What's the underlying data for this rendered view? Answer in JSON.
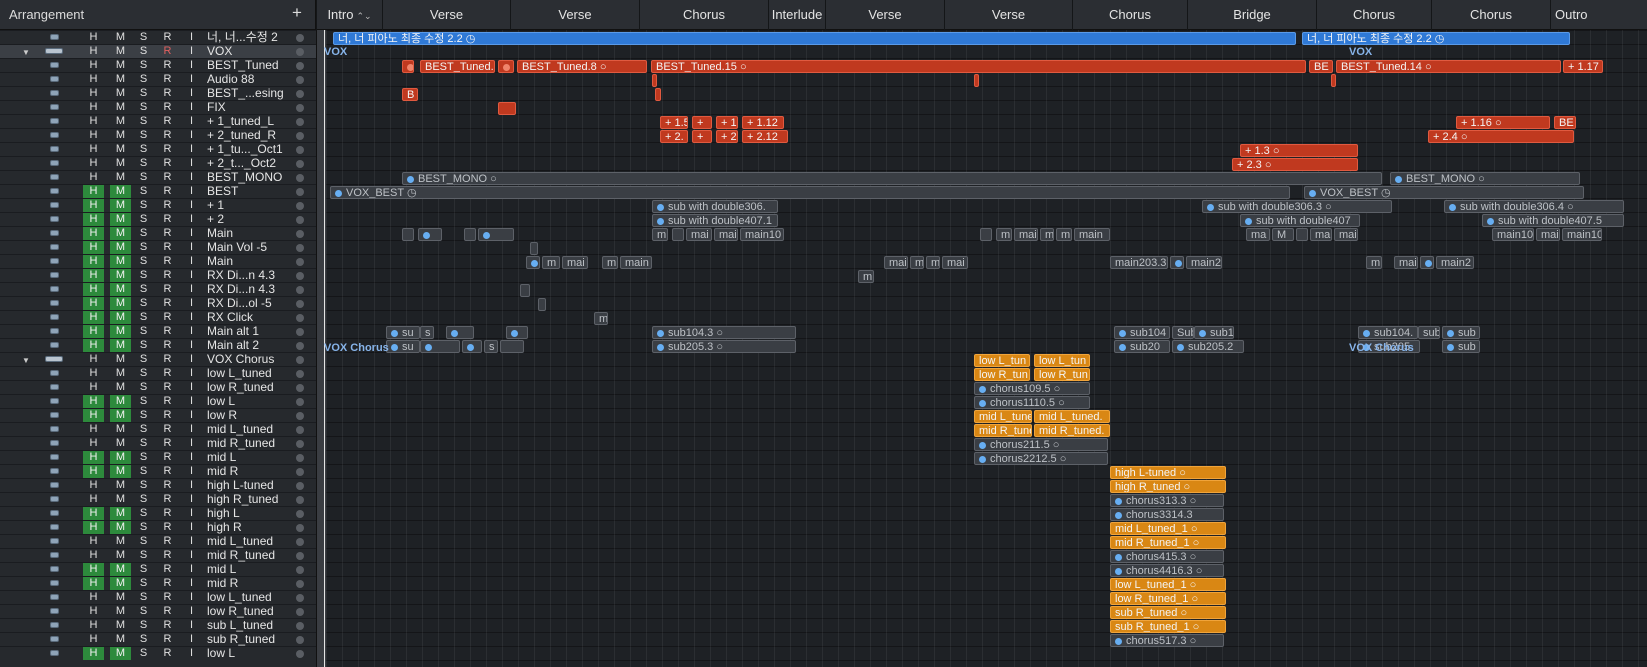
{
  "header": {
    "title": "Arrangement",
    "add": "+"
  },
  "markers": [
    {
      "label": "Intro",
      "caret": "⌃⌄"
    },
    {
      "label": "Verse"
    },
    {
      "label": "Verse"
    },
    {
      "label": "Chorus"
    },
    {
      "label": "Interlude"
    },
    {
      "label": "Verse"
    },
    {
      "label": "Verse"
    },
    {
      "label": "Chorus"
    },
    {
      "label": "Bridge"
    },
    {
      "label": "Chorus"
    },
    {
      "label": "Chorus"
    },
    {
      "label": "Outro"
    }
  ],
  "tracks": [
    {
      "num": "1",
      "name": "너, 너...수정 2",
      "h": "H",
      "m": "M",
      "s": "S",
      "r": "R",
      "i": "I"
    },
    {
      "num": "2",
      "name": "VOX",
      "h": "H",
      "m": "M",
      "s": "S",
      "r": "R",
      "i": "I"
    },
    {
      "num": "3",
      "name": "BEST_Tuned",
      "h": "H",
      "m": "M",
      "s": "S",
      "r": "R",
      "i": "I"
    },
    {
      "num": "4",
      "name": "Audio 88",
      "h": "H",
      "m": "M",
      "s": "S",
      "r": "R",
      "i": "I"
    },
    {
      "num": "5",
      "name": "BEST_...esing",
      "h": "H",
      "m": "M",
      "s": "S",
      "r": "R",
      "i": "I"
    },
    {
      "num": "6",
      "name": "FIX",
      "h": "H",
      "m": "M",
      "s": "S",
      "r": "R",
      "i": "I"
    },
    {
      "num": "7",
      "name": "+ 1_tuned_L",
      "h": "H",
      "m": "M",
      "s": "S",
      "r": "R",
      "i": "I"
    },
    {
      "num": "8",
      "name": "+ 2_tuned_R",
      "h": "H",
      "m": "M",
      "s": "S",
      "r": "R",
      "i": "I"
    },
    {
      "num": "9",
      "name": "+ 1_tu..._Oct1",
      "h": "H",
      "m": "M",
      "s": "S",
      "r": "R",
      "i": "I"
    },
    {
      "num": "0",
      "name": "+ 2_t..._Oct2",
      "h": "H",
      "m": "M",
      "s": "S",
      "r": "R",
      "i": "I"
    },
    {
      "num": "1",
      "name": "BEST_MONO",
      "h": "H",
      "m": "M",
      "s": "S",
      "r": "R",
      "i": "I"
    },
    {
      "num": "2",
      "name": "BEST",
      "h": "H",
      "m": "M",
      "s": "S",
      "r": "R",
      "i": "I"
    },
    {
      "num": "3",
      "name": "+ 1",
      "h": "H",
      "m": "M",
      "s": "S",
      "r": "R",
      "i": "I"
    },
    {
      "num": "4",
      "name": "+ 2",
      "h": "H",
      "m": "M",
      "s": "S",
      "r": "R",
      "i": "I"
    },
    {
      "num": "5",
      "name": "Main",
      "h": "H",
      "m": "M",
      "s": "S",
      "r": "R",
      "i": "I"
    },
    {
      "num": "6",
      "name": "Main Vol -5",
      "h": "H",
      "m": "M",
      "s": "S",
      "r": "R",
      "i": "I"
    },
    {
      "num": "7",
      "name": "Main",
      "h": "H",
      "m": "M",
      "s": "S",
      "r": "R",
      "i": "I"
    },
    {
      "num": "8",
      "name": "RX Di...n 4.3",
      "h": "H",
      "m": "M",
      "s": "S",
      "r": "R",
      "i": "I"
    },
    {
      "num": "9",
      "name": "RX Di...n 4.3",
      "h": "H",
      "m": "M",
      "s": "S",
      "r": "R",
      "i": "I"
    },
    {
      "num": "0",
      "name": "RX Di...ol -5",
      "h": "H",
      "m": "M",
      "s": "S",
      "r": "R",
      "i": "I"
    },
    {
      "num": "1",
      "name": "RX Click",
      "h": "H",
      "m": "M",
      "s": "S",
      "r": "R",
      "i": "I"
    },
    {
      "num": "2",
      "name": "Main alt 1",
      "h": "H",
      "m": "M",
      "s": "S",
      "r": "R",
      "i": "I"
    },
    {
      "num": "3",
      "name": "Main alt 2",
      "h": "H",
      "m": "M",
      "s": "S",
      "r": "R",
      "i": "I"
    },
    {
      "num": "4",
      "name": "VOX Chorus",
      "h": "H",
      "m": "M",
      "s": "S",
      "r": "R",
      "i": "I"
    },
    {
      "num": "5",
      "name": "low L_tuned",
      "h": "H",
      "m": "M",
      "s": "S",
      "r": "R",
      "i": "I"
    },
    {
      "num": "6",
      "name": "low R_tuned",
      "h": "H",
      "m": "M",
      "s": "S",
      "r": "R",
      "i": "I"
    },
    {
      "num": "7",
      "name": "low L",
      "h": "H",
      "m": "M",
      "s": "S",
      "r": "R",
      "i": "I"
    },
    {
      "num": "8",
      "name": "low R",
      "h": "H",
      "m": "M",
      "s": "S",
      "r": "R",
      "i": "I"
    },
    {
      "num": "9",
      "name": "mid L_tuned",
      "h": "H",
      "m": "M",
      "s": "S",
      "r": "R",
      "i": "I"
    },
    {
      "num": "0",
      "name": "mid R_tuned",
      "h": "H",
      "m": "M",
      "s": "S",
      "r": "R",
      "i": "I"
    },
    {
      "num": "1",
      "name": "mid L",
      "h": "H",
      "m": "M",
      "s": "S",
      "r": "R",
      "i": "I"
    },
    {
      "num": "2",
      "name": "mid R",
      "h": "H",
      "m": "M",
      "s": "S",
      "r": "R",
      "i": "I"
    },
    {
      "num": "3",
      "name": "high L-tuned",
      "h": "H",
      "m": "M",
      "s": "S",
      "r": "R",
      "i": "I"
    },
    {
      "num": "4",
      "name": "high R_tuned",
      "h": "H",
      "m": "M",
      "s": "S",
      "r": "R",
      "i": "I"
    },
    {
      "num": "5",
      "name": "high L",
      "h": "H",
      "m": "M",
      "s": "S",
      "r": "R",
      "i": "I"
    },
    {
      "num": "6",
      "name": "high R",
      "h": "H",
      "m": "M",
      "s": "S",
      "r": "R",
      "i": "I"
    },
    {
      "num": "7",
      "name": "mid L_tuned",
      "h": "H",
      "m": "M",
      "s": "S",
      "r": "R",
      "i": "I"
    },
    {
      "num": "8",
      "name": "mid R_tuned",
      "h": "H",
      "m": "M",
      "s": "S",
      "r": "R",
      "i": "I"
    },
    {
      "num": "9",
      "name": "mid L",
      "h": "H",
      "m": "M",
      "s": "S",
      "r": "R",
      "i": "I"
    },
    {
      "num": "0",
      "name": "mid R",
      "h": "H",
      "m": "M",
      "s": "S",
      "r": "R",
      "i": "I"
    },
    {
      "num": "1",
      "name": "low L_tuned",
      "h": "H",
      "m": "M",
      "s": "S",
      "r": "R",
      "i": "I"
    },
    {
      "num": "2",
      "name": "low R_tuned",
      "h": "H",
      "m": "M",
      "s": "S",
      "r": "R",
      "i": "I"
    },
    {
      "num": "3",
      "name": "sub L_tuned",
      "h": "H",
      "m": "M",
      "s": "S",
      "r": "R",
      "i": "I"
    },
    {
      "num": "4",
      "name": "sub R_tuned",
      "h": "H",
      "m": "M",
      "s": "S",
      "r": "R",
      "i": "I"
    },
    {
      "num": "5",
      "name": "low L",
      "h": "H",
      "m": "M",
      "s": "S",
      "r": "R",
      "i": "I"
    }
  ],
  "lanes": {
    "vox_label": "VOX",
    "vox_label_2": "VOX",
    "vox_chorus": "VOX Chorus",
    "vox_chorus_2": "VOX Chorus",
    "summary": "너, 너 피아노 최종 수정 2.2",
    "summary_2": "너, 너 피아노 최종 수정 2.2",
    "best_tuned": [
      "BEST_Tuned.",
      "BEST_Tuned.8",
      "BEST_Tuned.15",
      "BE",
      "BEST_Tuned.14",
      "+ 1.17"
    ],
    "best_esing": "B",
    "tuned_L": [
      "+ 1.5",
      "+",
      "+ 1",
      "+ 1.12",
      "+ 1.16",
      "BE"
    ],
    "tuned_R": [
      "+ 2.",
      "+",
      "+ 2",
      "+ 2.12",
      "+ 2.4"
    ],
    "oct1": "+ 1.3",
    "oct2": "+ 2.3",
    "best_mono": [
      "BEST_MONO",
      "BEST_MONO"
    ],
    "best": [
      "VOX_BEST",
      "VOX_BEST"
    ],
    "plus1": [
      "sub with double306.",
      "sub with double306.3",
      "sub with double306.4"
    ],
    "plus2": [
      "sub with double407.1",
      "sub with double407",
      "sub with double407.5"
    ],
    "main": [
      "m",
      "mai",
      "mai",
      "main10",
      "m",
      "mai",
      "m",
      "m",
      "main",
      "ma",
      "M",
      "ma",
      "mai",
      "main102.6",
      "mai",
      "main102"
    ],
    "main3": [
      "m",
      "mai",
      "m",
      "main",
      "mai",
      "m",
      "m",
      "mai",
      "main203.3",
      "main2",
      "m",
      "mai",
      "main2"
    ],
    "rx_click": "m",
    "alt1": [
      "su",
      "s",
      "sub104.3",
      "sub104",
      "Sub",
      "sub1",
      "sub104.",
      "sub",
      "sub"
    ],
    "alt2": [
      "su",
      "s",
      "sub205.3",
      "sub20",
      "sub205.2",
      "sub205",
      "sub"
    ],
    "chorus_low": [
      "low L_tun",
      "low L_tun",
      "low R_tun",
      "low R_tun"
    ],
    "chorus_mid": [
      "mid L_tune",
      "mid L_tuned.",
      "mid R_tune",
      "mid R_tuned."
    ],
    "chorus_gr": [
      "chorus109.5",
      "chorus1110.5",
      "chorus211.5",
      "chorus2212.5",
      "chorus313.3",
      "chorus3314.3",
      "chorus415.3",
      "chorus4416.3",
      "chorus517.3"
    ],
    "chorus_hi": [
      "high L-tuned",
      "high R_tuned"
    ],
    "chorus_mid2": [
      "mid L_tuned_1",
      "mid R_tuned_1"
    ],
    "chorus_low2": [
      "low L_tuned_1",
      "low R_tuned_1"
    ],
    "chorus_sub": [
      "sub R_tuned",
      "sub R_tuned_1"
    ]
  },
  "colors": {
    "region_red": "#c0391f",
    "region_orange": "#d98714",
    "region_gray": "#3a3e44",
    "region_blue": "#2f79d6",
    "toggle_green": "#2d8a3c",
    "label_blue": "#87b4ea"
  }
}
